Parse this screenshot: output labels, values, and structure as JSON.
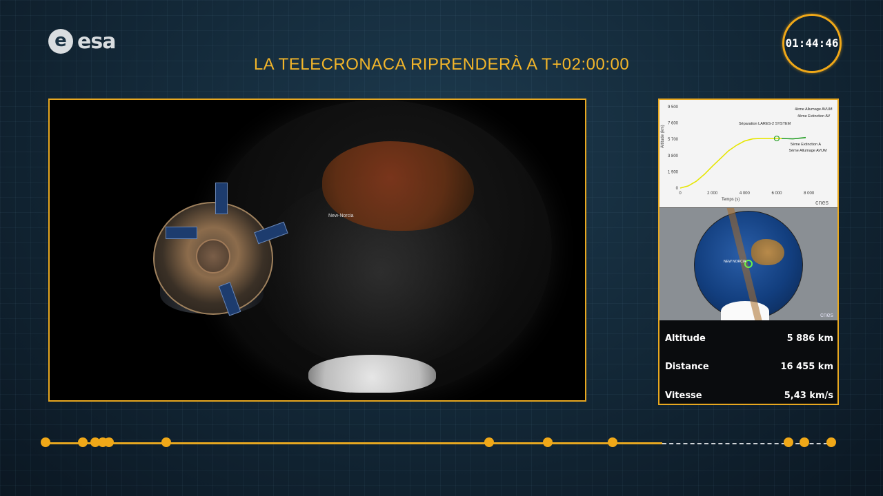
{
  "branding": {
    "logo_text": "esa",
    "logo_mark": "e"
  },
  "clock": {
    "time": "01:44:46"
  },
  "headline": "LA TELECRONACA RIPRENDERÀ A T+02:00:00",
  "video": {
    "location_label": "New-Norcia"
  },
  "graph": {
    "y_axis_label": "Altitude (km)",
    "x_axis_label": "Temps (s)",
    "y_ticks": [
      "9 500",
      "7 600",
      "5 700",
      "3 800",
      "1 900",
      "0"
    ],
    "x_ticks": [
      "0",
      "2 000",
      "4 000",
      "6 000",
      "8 000"
    ],
    "events": [
      "Séparation  LARES-2 SYSTEM",
      "4ème Allumage AVUM",
      "4ème Extinction AV",
      "5ème Extinction A",
      "5ème Allumage AVUM"
    ],
    "credit": "cnes",
    "chart_data": {
      "type": "line",
      "title": "",
      "xlabel": "Temps (s)",
      "ylabel": "Altitude (km)",
      "xlim": [
        0,
        9000
      ],
      "ylim": [
        0,
        9500
      ],
      "series": [
        {
          "x": [
            0,
            500,
            1000,
            1500,
            2000,
            2500,
            3000,
            3500,
            4000,
            4500,
            5000,
            5500,
            6000,
            6300
          ],
          "y": [
            0,
            250,
            800,
            1600,
            2550,
            3450,
            4350,
            5000,
            5500,
            5750,
            5800,
            5800,
            5800,
            5800
          ]
        },
        {
          "x": [
            6300,
            7000,
            7800
          ],
          "y": [
            5800,
            5750,
            5900
          ]
        }
      ]
    }
  },
  "globe": {
    "city": "NEW NORCIA",
    "credit": "cnes"
  },
  "stats": [
    {
      "label": "Altitude",
      "value": "5 886 km"
    },
    {
      "label": "Distance",
      "value": "16 455 km"
    },
    {
      "label": "Vitesse",
      "value": "5,43 km/s"
    }
  ],
  "timeline": {
    "progress": 0.78,
    "dot_count": 13
  }
}
